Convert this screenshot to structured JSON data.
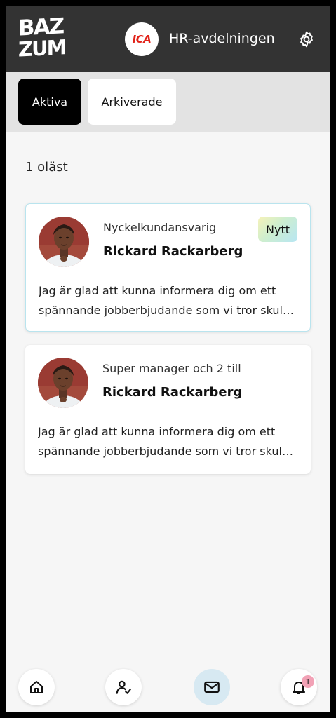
{
  "header": {
    "logo_line1": "BAZ",
    "logo_line2": "ZUM",
    "company_logo_text": "ICA",
    "company_name": "HR-avdelningen",
    "settings_icon": "gear-icon"
  },
  "tabs": [
    {
      "label": "Aktiva",
      "active": true
    },
    {
      "label": "Arkiverade",
      "active": false
    }
  ],
  "unread_count_label": "1 oläst",
  "messages": [
    {
      "role": "Nyckelkundansvarig",
      "sender": "Rickard Rackarberg",
      "badge": "Nytt",
      "line1": "Jag är glad att kunna informera dig om ett",
      "line2": "spännande jobberbjudande som vi tror skul…"
    },
    {
      "role": "Super manager och 2 till",
      "sender": "Rickard Rackarberg",
      "line1": "Jag är glad att kunna informera dig om ett",
      "line2": "spännande jobberbjudande som vi tror skul…"
    }
  ],
  "bottom_nav": {
    "items": [
      "home-icon",
      "candidates-icon",
      "messages-icon",
      "notifications-icon"
    ],
    "active": "messages-icon",
    "notification_count": "1"
  },
  "colors": {
    "header_bg": "#333333",
    "accent": "#d7e9f2",
    "brand_red": "#e2231a",
    "badge_pink": "#f2a2b6"
  }
}
